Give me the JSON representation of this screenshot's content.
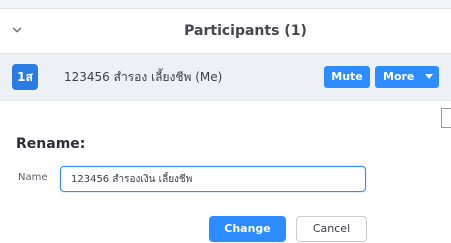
{
  "header": {
    "title": "Participants (1)",
    "collapse_icon": "chevron-down-icon"
  },
  "participant": {
    "avatar_text": "1ส",
    "name": "123456 สำรอง เลี้ยงชีพ (Me)",
    "mute_label": "Mute",
    "more_label": "More",
    "more_icon": "caret-down-icon"
  },
  "rename": {
    "title": "Rename:",
    "field_label": "Name",
    "field_value": "123456 สำรองเงิน เลี้ยงชีพ",
    "change_label": "Change",
    "cancel_label": "Cancel"
  },
  "colors": {
    "accent": "#2d8cff",
    "avatar": "#2a7be4",
    "row_background": "#edf0f5"
  }
}
